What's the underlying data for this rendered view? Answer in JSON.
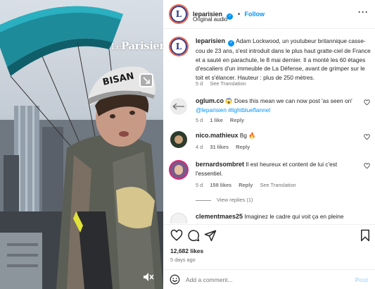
{
  "media": {
    "watermark_prefix": "Le",
    "watermark_name": "Parisien",
    "helmet_text": "BISAN",
    "tag_icon": "tag-people-icon",
    "mute_icon": "muted-speaker-icon"
  },
  "header": {
    "username": "leparisien",
    "separator": "•",
    "follow_label": "Follow",
    "audio_label": "Original audio",
    "more_icon": "more-horizontal-icon"
  },
  "post": {
    "avatar_letter": "L",
    "username": "leparisien",
    "caption": "Adam Lockwood, un youtubeur britannique casse-cou de 23 ans, s'est introduit dans le plus haut gratte-ciel de France et a sauté en parachute, le 8 mai dernier. Il a monté les 60 étages d'escaliers d'un immeuble de La Défense, avant de grimper sur le toit et s'élancer. Hauteur : plus de 250 mètres.",
    "age": "5 d",
    "see_translation": "See Translation"
  },
  "comments": [
    {
      "username": "oglum.co",
      "text_before": "😱 Does this mean we can now post 'as seen on'",
      "links": "@leparisien #lightblueflannel",
      "age": "5 d",
      "likes": "1 like",
      "reply": "Reply"
    },
    {
      "username": "nico.mathieux",
      "text_before": "Bg 🔥",
      "age": "4 d",
      "likes": "31 likes",
      "reply": "Reply"
    },
    {
      "username": "bernardsombret",
      "text_before": "Il est heureux et content de lui c'est l'essentiel.",
      "age": "5 d",
      "likes": "159 likes",
      "reply": "Reply",
      "see_translation": "See Translation"
    },
    {
      "username": "clementmaes25",
      "text_before": "Imaginez le cadre qui voit ça en pleine réunion"
    }
  ],
  "view_replies": "View replies (1)",
  "actions": {
    "like_icon": "heart-icon",
    "comment_icon": "comment-bubble-icon",
    "share_icon": "paper-plane-icon",
    "save_icon": "bookmark-icon"
  },
  "likes_count": "12,682 likes",
  "posted_ago": "5 days ago",
  "add_comment": {
    "placeholder": "Add a comment...",
    "post_label": "Post",
    "emoji_icon": "smiley-icon"
  },
  "colors": {
    "accent": "#0095f6",
    "text": "#262626",
    "secondary": "#737373",
    "heart_red": "#ff3040"
  }
}
